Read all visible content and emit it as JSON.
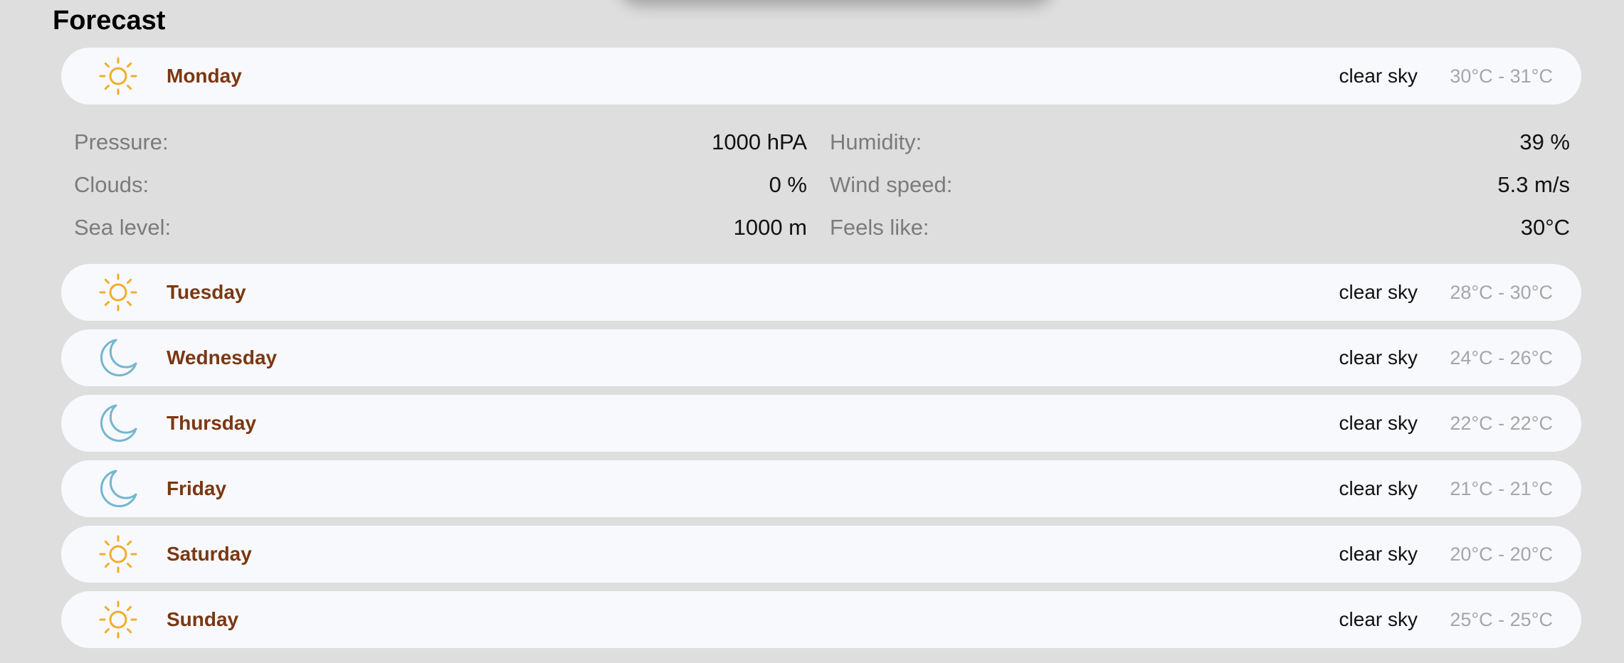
{
  "title": "Forecast",
  "days": [
    {
      "name": "Monday",
      "description": "clear sky",
      "temp_range": "30°C - 31°C",
      "icon": "sun-icon"
    },
    {
      "name": "Tuesday",
      "description": "clear sky",
      "temp_range": "28°C - 30°C",
      "icon": "sun-icon"
    },
    {
      "name": "Wednesday",
      "description": "clear sky",
      "temp_range": "24°C - 26°C",
      "icon": "moon-icon"
    },
    {
      "name": "Thursday",
      "description": "clear sky",
      "temp_range": "22°C - 22°C",
      "icon": "moon-icon"
    },
    {
      "name": "Friday",
      "description": "clear sky",
      "temp_range": "21°C - 21°C",
      "icon": "moon-icon"
    },
    {
      "name": "Saturday",
      "description": "clear sky",
      "temp_range": "20°C - 20°C",
      "icon": "sun-icon"
    },
    {
      "name": "Sunday",
      "description": "clear sky",
      "temp_range": "25°C - 25°C",
      "icon": "sun-icon"
    }
  ],
  "details": {
    "pressure": {
      "label": "Pressure:",
      "value": "1000 hPA"
    },
    "humidity": {
      "label": "Humidity:",
      "value": "39 %"
    },
    "clouds": {
      "label": "Clouds:",
      "value": "0 %"
    },
    "wind_speed": {
      "label": "Wind speed:",
      "value": "5.3 m/s"
    },
    "sea_level": {
      "label": "Sea level:",
      "value": "1000 m"
    },
    "feels_like": {
      "label": "Feels like:",
      "value": "30°C"
    }
  },
  "colors": {
    "sun": "#f0ad2c",
    "moon": "#74b6cf",
    "day_name": "#7a3812",
    "background": "#dedede",
    "row": "#f8f9fd"
  }
}
